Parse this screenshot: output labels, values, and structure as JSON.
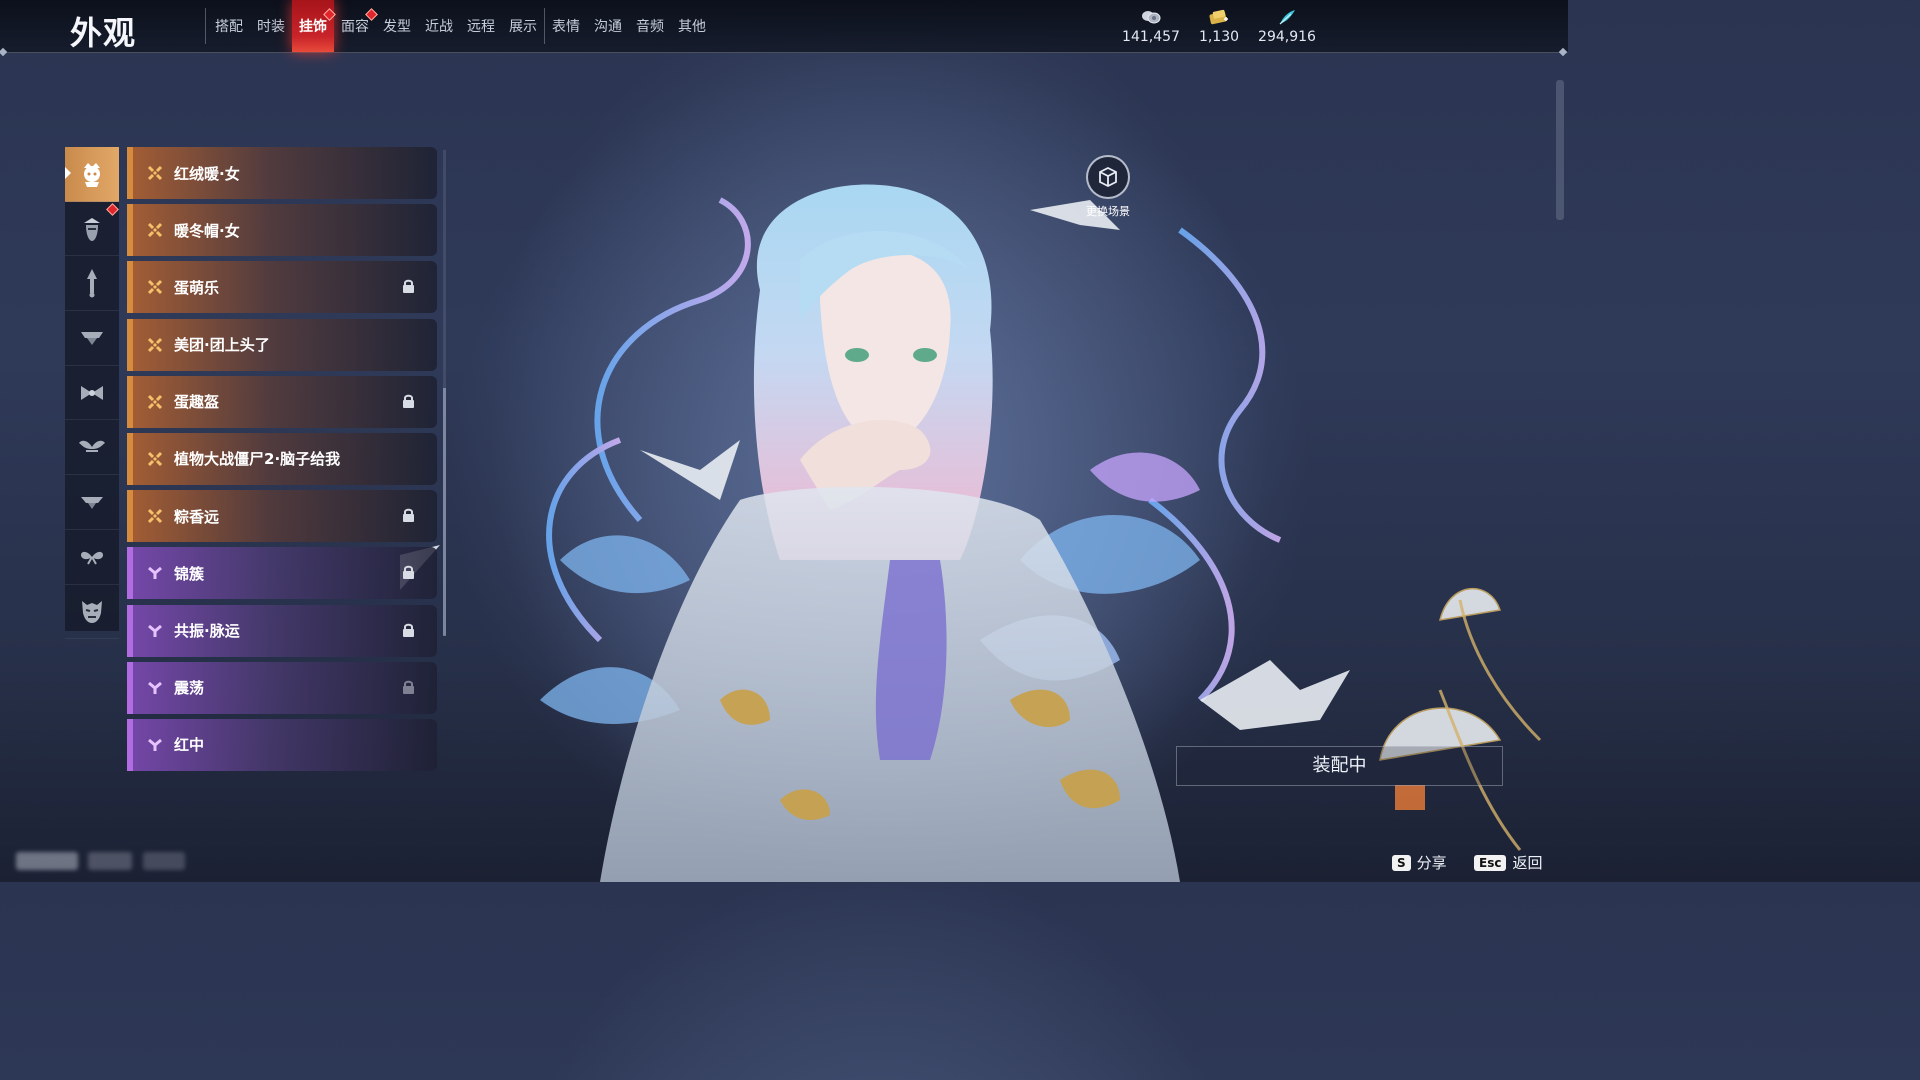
{
  "header": {
    "title": "外观",
    "tabs": [
      {
        "label": "搭配",
        "active": false,
        "badge": false
      },
      {
        "label": "时装",
        "active": false,
        "badge": false
      },
      {
        "label": "挂饰",
        "active": true,
        "badge": true
      },
      {
        "label": "面容",
        "active": false,
        "badge": true
      },
      {
        "label": "发型",
        "active": false,
        "badge": false
      },
      {
        "label": "近战",
        "active": false,
        "badge": false
      },
      {
        "label": "远程",
        "active": false,
        "badge": false
      },
      {
        "label": "展示",
        "active": false,
        "badge": false
      },
      {
        "label": "表情",
        "active": false,
        "badge": false
      },
      {
        "label": "沟通",
        "active": false,
        "badge": false
      },
      {
        "label": "音频",
        "active": false,
        "badge": false
      },
      {
        "label": "其他",
        "active": false,
        "badge": false
      }
    ],
    "currencies": [
      {
        "icon": "coin-stack-icon",
        "value": "141,457"
      },
      {
        "icon": "gold-ticket-icon",
        "value": "1,130"
      },
      {
        "icon": "feather-currency-icon",
        "value": "294,916"
      }
    ]
  },
  "categories": [
    {
      "icon": "head-accessory-icon",
      "active": true,
      "badge": false
    },
    {
      "icon": "face-accessory-icon",
      "active": false,
      "badge": true
    },
    {
      "icon": "back-accessory-icon",
      "active": false,
      "badge": false
    },
    {
      "icon": "waist-accessory-icon",
      "active": false,
      "badge": false
    },
    {
      "icon": "bow-accessory-icon",
      "active": false,
      "badge": false
    },
    {
      "icon": "wing-accessory-icon",
      "active": false,
      "badge": false
    },
    {
      "icon": "hat-accessory-icon",
      "active": false,
      "badge": false
    },
    {
      "icon": "butterfly-accessory-icon",
      "active": false,
      "badge": false
    },
    {
      "icon": "mask-accessory-icon",
      "active": false,
      "badge": false
    }
  ],
  "items": [
    {
      "name": "红绒暖·女",
      "rarity": "orange",
      "locked": false
    },
    {
      "name": "暖冬帽·女",
      "rarity": "orange",
      "locked": false
    },
    {
      "name": "蛋萌乐",
      "rarity": "orange",
      "locked": true
    },
    {
      "name": "美团·团上头了",
      "rarity": "orange",
      "locked": false
    },
    {
      "name": "蛋趣盔",
      "rarity": "orange",
      "locked": true
    },
    {
      "name": "植物大战僵尸2·脑子给我",
      "rarity": "orange",
      "locked": false
    },
    {
      "name": "粽香远",
      "rarity": "orange",
      "locked": true
    },
    {
      "name": "锦簇",
      "rarity": "purple",
      "locked": true
    },
    {
      "name": "共振·脉运",
      "rarity": "purple",
      "locked": true
    },
    {
      "name": "震荡",
      "rarity": "purple",
      "locked": true
    },
    {
      "name": "红中",
      "rarity": "purple",
      "locked": false
    }
  ],
  "scene": {
    "label": "更换场景",
    "icon": "cube-scene-icon"
  },
  "equip": {
    "label": "装配中"
  },
  "hotkeys": [
    {
      "key": "S",
      "label": "分享"
    },
    {
      "key": "Esc",
      "label": "返回"
    }
  ],
  "colors": {
    "accent_red": "#c8242a",
    "orange_rarity": "#d68b3d",
    "purple_rarity": "#b06ce0"
  }
}
